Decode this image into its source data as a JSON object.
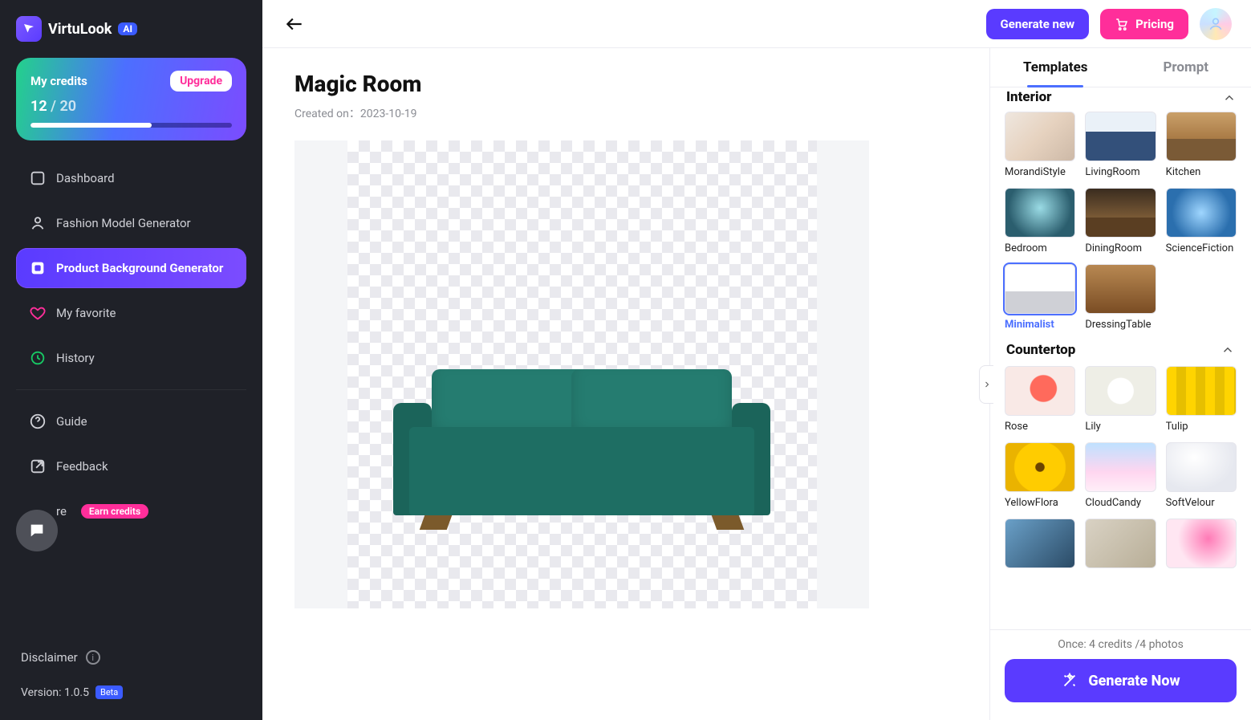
{
  "brand": {
    "name": "VirtuLook",
    "ai_badge": "AI"
  },
  "credits": {
    "label": "My credits",
    "upgrade": "Upgrade",
    "current": "12",
    "max": "20"
  },
  "sidebar": {
    "items": [
      {
        "label": "Dashboard",
        "name": "sidebar-item-dashboard"
      },
      {
        "label": "Fashion Model Generator",
        "name": "sidebar-item-fashion-model-generator"
      },
      {
        "label": "Product Background Generator",
        "name": "sidebar-item-product-background-generator",
        "active": true
      },
      {
        "label": "My favorite",
        "name": "sidebar-item-favorite"
      },
      {
        "label": "History",
        "name": "sidebar-item-history"
      }
    ]
  },
  "sidebar2": {
    "guide": "Guide",
    "feedback": "Feedback",
    "share": "re",
    "earn": "Earn credits",
    "disclaimer": "Disclaimer",
    "version_label": "Version: 1.0.5",
    "beta": "Beta"
  },
  "topbar": {
    "generate_new": "Generate new",
    "pricing": "Pricing"
  },
  "page": {
    "title": "Magic Room",
    "created_label": "Created on：",
    "created_date": "2023-10-19"
  },
  "tabs": {
    "templates": "Templates",
    "prompt": "Prompt"
  },
  "sections": {
    "interior": {
      "title": "Interior",
      "items": [
        {
          "label": "MorandiStyle",
          "name": "template-morandistyle",
          "bg": "bg-morandi"
        },
        {
          "label": "LivingRoom",
          "name": "template-livingroom",
          "bg": "bg-living"
        },
        {
          "label": "Kitchen",
          "name": "template-kitchen",
          "bg": "bg-kitchen"
        },
        {
          "label": "Bedroom",
          "name": "template-bedroom",
          "bg": "bg-bedroom"
        },
        {
          "label": "DiningRoom",
          "name": "template-diningroom",
          "bg": "bg-dining"
        },
        {
          "label": "ScienceFiction",
          "name": "template-sciencefiction",
          "bg": "bg-scifi"
        },
        {
          "label": "Minimalist",
          "name": "template-minimalist",
          "bg": "bg-minimal",
          "selected": true
        },
        {
          "label": "DressingTable",
          "name": "template-dressingtable",
          "bg": "bg-dresser"
        }
      ]
    },
    "countertop": {
      "title": "Countertop",
      "items": [
        {
          "label": "Rose",
          "name": "template-rose",
          "bg": "bg-rose"
        },
        {
          "label": "Lily",
          "name": "template-lily",
          "bg": "bg-lily"
        },
        {
          "label": "Tulip",
          "name": "template-tulip",
          "bg": "bg-tulip"
        },
        {
          "label": "YellowFlora",
          "name": "template-yellowflora",
          "bg": "bg-sun"
        },
        {
          "label": "CloudCandy",
          "name": "template-cloudcandy",
          "bg": "bg-cloud"
        },
        {
          "label": "SoftVelour",
          "name": "template-softvelour",
          "bg": "bg-velour"
        }
      ]
    }
  },
  "footer": {
    "cost": "Once: 4 credits /4 photos",
    "generate_now": "Generate Now"
  }
}
